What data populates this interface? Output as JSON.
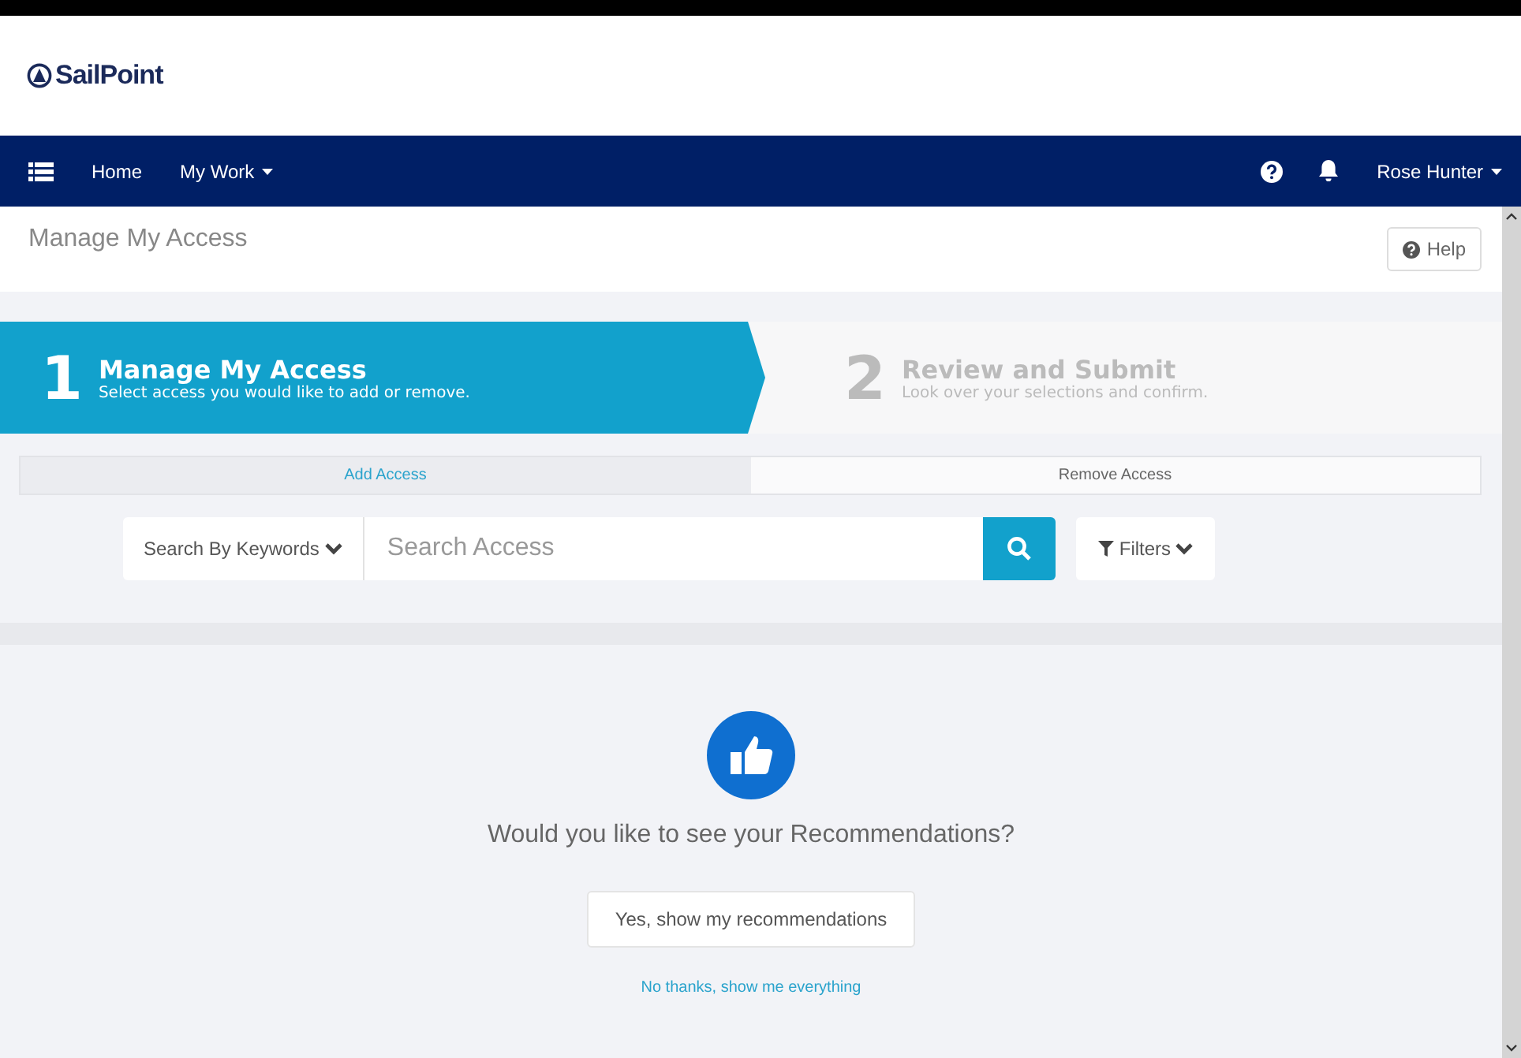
{
  "logo": {
    "text": "SailPoint"
  },
  "nav": {
    "items": [
      {
        "label": "Home",
        "dropdown": false
      },
      {
        "label": "My Work",
        "dropdown": true
      }
    ],
    "user": "Rose Hunter"
  },
  "page": {
    "title": "Manage My Access",
    "help_button": "Help"
  },
  "steps": [
    {
      "number": "1",
      "title": "Manage My Access",
      "subtitle": "Select access you would like to add or remove.",
      "selected": true
    },
    {
      "number": "2",
      "title": "Review and Submit",
      "subtitle": "Look over your selections and confirm.",
      "selected": false
    }
  ],
  "tabs": [
    {
      "label": "Add Access",
      "selected": true
    },
    {
      "label": "Remove Access",
      "selected": false
    }
  ],
  "search": {
    "mode": "Search By Keywords",
    "placeholder": "Search Access",
    "filters": "Filters"
  },
  "recommendations": {
    "question": "Would you like to see your Recommendations?",
    "yes_button": "Yes, show my recommendations",
    "no_link": "No thanks, show me everything"
  }
}
